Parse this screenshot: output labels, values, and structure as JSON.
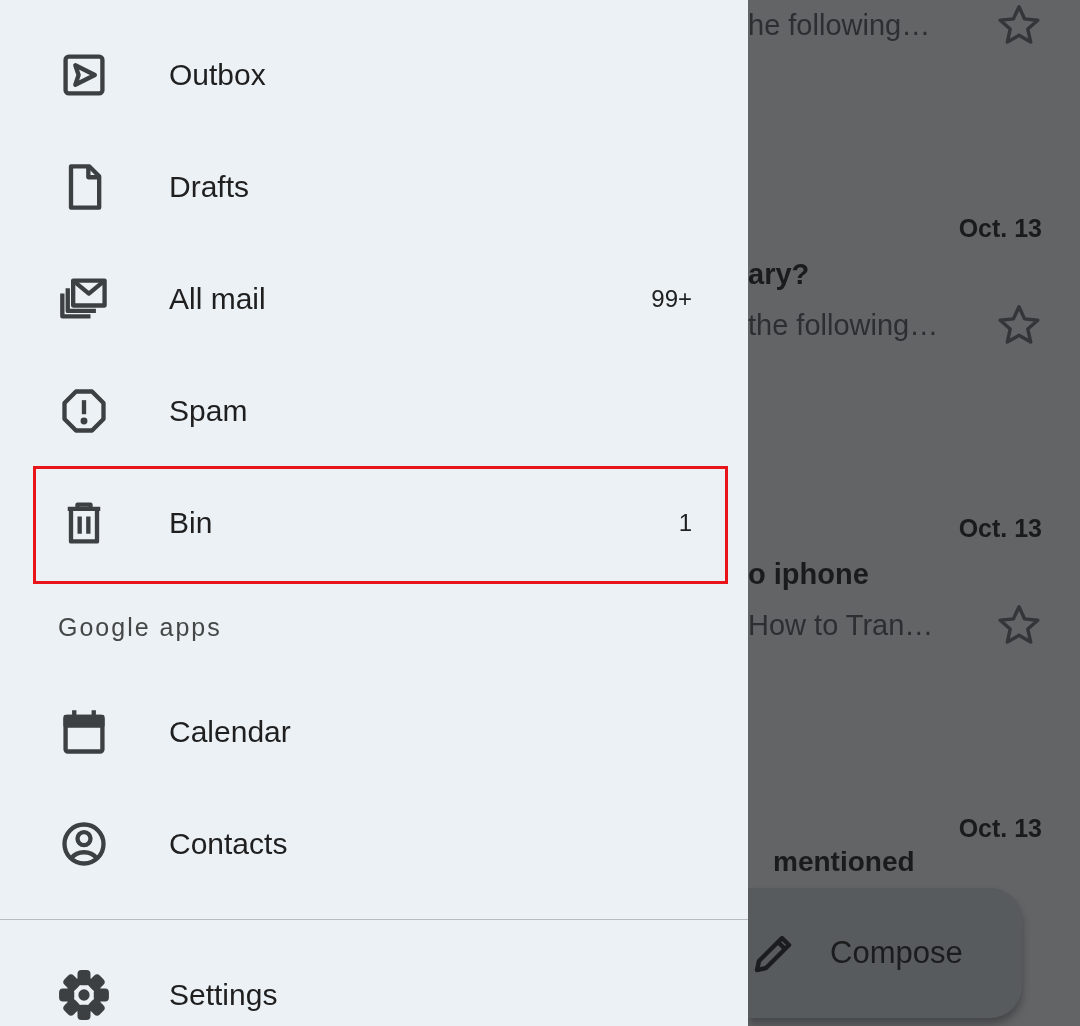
{
  "drawer": {
    "folders": [
      {
        "label": "Outbox",
        "highlighted": false
      },
      {
        "label": "Drafts",
        "highlighted": false
      },
      {
        "label": "All mail",
        "count": "99+",
        "highlighted": false
      },
      {
        "label": "Spam",
        "highlighted": false
      },
      {
        "label": "Bin",
        "count": "1",
        "highlighted": true
      }
    ],
    "section_title": "Google apps",
    "apps": [
      {
        "label": "Calendar"
      },
      {
        "label": "Contacts"
      }
    ],
    "settings": {
      "label": "Settings"
    }
  },
  "mail_list": [
    {
      "snippet": "he following…"
    },
    {
      "date": "Oct. 13",
      "subject": "ary?",
      "snippet": "the following…"
    },
    {
      "date": "Oct. 13",
      "subject": "o iphone",
      "snippet": "How to Tran…"
    },
    {
      "date": "Oct. 13",
      "subject": "mentioned"
    }
  ],
  "compose": {
    "label": "Compose"
  }
}
